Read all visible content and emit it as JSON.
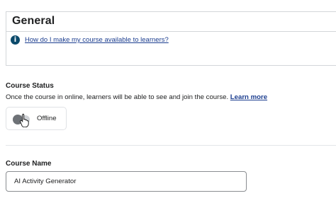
{
  "general": {
    "title": "General",
    "help_link": "How do I make my course available to learners?",
    "info_icon": "info-icon"
  },
  "course_status": {
    "label": "Course Status",
    "description": "Once the course in online, learners will be able to see and join the course.",
    "learn_more": "Learn more",
    "toggle_label": "Offline",
    "toggle_on": false
  },
  "course_name": {
    "label": "Course Name",
    "value": "AI Activity Generator"
  },
  "colors": {
    "link": "#1b3d8f",
    "info_icon_bg": "#0b4a6b",
    "toggle_track": "#cfd2d6",
    "toggle_knob": "#6e7277",
    "border": "#d3d6d9"
  }
}
